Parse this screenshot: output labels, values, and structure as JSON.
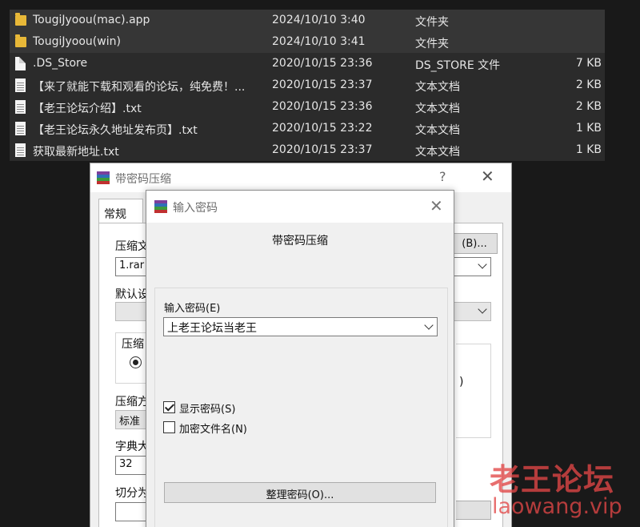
{
  "files": [
    {
      "icon": "folder-icon",
      "name": "TougiJyoou(mac).app",
      "date": "2024/10/10 3:40",
      "type": "文件夹",
      "size": ""
    },
    {
      "icon": "folder-icon",
      "name": "TougiJyoou(win)",
      "date": "2024/10/10 3:41",
      "type": "文件夹",
      "size": ""
    },
    {
      "icon": "file-icon",
      "name": ".DS_Store",
      "date": "2020/10/15 23:36",
      "type": "DS_STORE 文件",
      "size": "7 KB"
    },
    {
      "icon": "text-file-icon",
      "name": "【来了就能下载和观看的论坛，纯免费！...",
      "date": "2020/10/15 23:37",
      "type": "文本文档",
      "size": "2 KB"
    },
    {
      "icon": "text-file-icon",
      "name": "【老王论坛介绍】.txt",
      "date": "2020/10/15 23:36",
      "type": "文本文档",
      "size": "2 KB"
    },
    {
      "icon": "text-file-icon",
      "name": "【老王论坛永久地址发布页】.txt",
      "date": "2020/10/15 23:22",
      "type": "文本文档",
      "size": "1 KB"
    },
    {
      "icon": "text-file-icon",
      "name": "获取最新地址.txt",
      "date": "2020/10/15 23:37",
      "type": "文本文档",
      "size": "1 KB"
    }
  ],
  "archive_dialog": {
    "title": "带密码压缩",
    "help": "?",
    "close": "✕",
    "tab_general": "常规",
    "archive_name_label": "压缩文",
    "archive_name_value": "1.rar",
    "browse_label": "(B)...",
    "default_settings_label": "默认设",
    "format_group_label": "压缩",
    "method_label": "压缩方",
    "method_value": "标准",
    "dict_label": "字典大",
    "dict_value": "32",
    "split_label": "切分为",
    "side_fragment": ")"
  },
  "password_dialog": {
    "title": "输入密码",
    "close": "✕",
    "heading": "带密码压缩",
    "password_label": "输入密码(E)",
    "password_value": "上老王论坛当老王",
    "show_password_label": "显示密码(S)",
    "show_password_checked": true,
    "encrypt_names_label": "加密文件名(N)",
    "encrypt_names_checked": false,
    "organize_button": "整理密码(O)..."
  },
  "watermark": {
    "title": "老王论坛",
    "url": "laowang.vip"
  },
  "colors": {
    "folder": "#e8b838",
    "selected_row": "#363636",
    "watermark": "#e24646"
  }
}
